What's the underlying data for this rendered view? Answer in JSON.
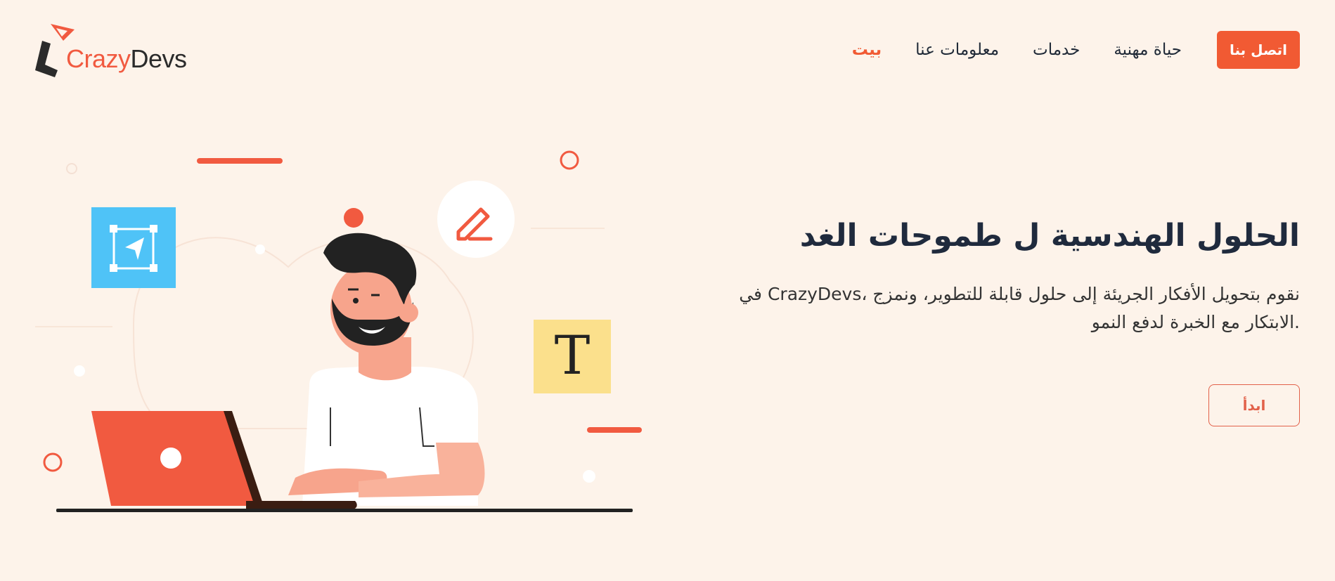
{
  "brand": {
    "part1": "Crazy",
    "part2": "Devs"
  },
  "nav": {
    "contact_label": "اتصل بنا",
    "items": [
      {
        "label": "حياة مهنية"
      },
      {
        "label": "خدمات"
      },
      {
        "label": "معلومات عنا"
      },
      {
        "label": "بيت"
      }
    ],
    "active": "بيت"
  },
  "hero": {
    "title": "الحلول الهندسية ل طموحات الغد",
    "description_line1": "نقوم بتحويل الأفكار الجريئة إلى حلول قابلة للتطوير، ونمزج ،CrazyDevs في",
    "description_line2": ".الابتكار مع الخبرة لدفع النمو",
    "start_label": "ابدأ"
  },
  "illustration": {
    "text_card_letter": "T"
  },
  "colors": {
    "accent": "#f15a33",
    "background": "#fdf3ea",
    "heading": "#1f2a3d"
  }
}
